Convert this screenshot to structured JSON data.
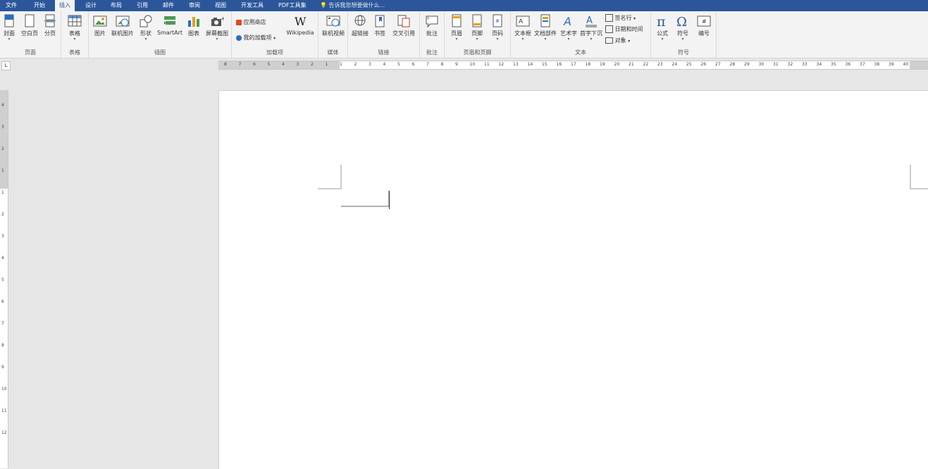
{
  "tabs": [
    "文件",
    "开始",
    "插入",
    "设计",
    "布局",
    "引用",
    "邮件",
    "审阅",
    "视图",
    "开发工具",
    "PDF工具集"
  ],
  "active_tab": "插入",
  "tell_me": "告诉我您想要做什么...",
  "groups": {
    "pages": {
      "label": "页面",
      "buttons": [
        "封面",
        "空白页",
        "分页"
      ]
    },
    "tables": {
      "label": "表格",
      "buttons": [
        "表格"
      ]
    },
    "illustrations": {
      "label": "插图",
      "buttons": [
        "图片",
        "联机图片",
        "形状",
        "SmartArt",
        "图表",
        "屏幕截图"
      ]
    },
    "addins": {
      "label": "加载项",
      "store": "应用商店",
      "my_addins": "我的加载项",
      "wikipedia": "Wikipedia"
    },
    "media": {
      "label": "媒体",
      "buttons": [
        "联机视频"
      ]
    },
    "links": {
      "label": "链接",
      "buttons": [
        "超链接",
        "书签",
        "交叉引用"
      ]
    },
    "comments": {
      "label": "批注",
      "buttons": [
        "批注"
      ]
    },
    "header_footer": {
      "label": "页眉和页脚",
      "buttons": [
        "页眉",
        "页脚",
        "页码"
      ]
    },
    "text": {
      "label": "文本",
      "buttons": [
        "文本框",
        "文档部件",
        "艺术字",
        "首字下沉"
      ],
      "small": [
        "签名行",
        "日期和时间",
        "对象"
      ]
    },
    "symbols": {
      "label": "符号",
      "buttons": [
        "公式",
        "符号",
        "编号"
      ]
    }
  },
  "ruler_numbers": [
    "8",
    "7",
    "6",
    "5",
    "4",
    "3",
    "2",
    "1",
    "1",
    "2",
    "3",
    "4",
    "5",
    "6",
    "7",
    "8",
    "9",
    "10",
    "11",
    "12",
    "13",
    "14",
    "15",
    "16",
    "17",
    "18",
    "19",
    "20",
    "21",
    "22",
    "23",
    "24",
    "25",
    "26",
    "27",
    "28",
    "29",
    "30",
    "31",
    "32",
    "33",
    "34",
    "35",
    "36",
    "37",
    "38",
    "39",
    "40"
  ],
  "vruler_numbers": [
    "4",
    "3",
    "2",
    "1",
    "1",
    "2",
    "3",
    "4",
    "5",
    "6",
    "7",
    "8",
    "9",
    "10",
    "11",
    "12"
  ],
  "ruler_corner": "L",
  "colors": {
    "title_bar": "#2b579a",
    "ribbon": "#f3f3f3"
  }
}
